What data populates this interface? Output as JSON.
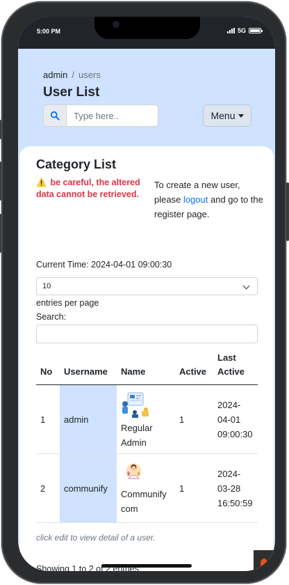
{
  "status_bar": {
    "time": "5:00 PM",
    "network": "5G"
  },
  "breadcrumb": {
    "root": "admin",
    "separator": "/",
    "current": "users"
  },
  "page_title": "User List",
  "search": {
    "placeholder": "Type here.."
  },
  "menu_button": "Menu",
  "card": {
    "title": "Category List",
    "warning": "be careful, the altered data cannot be retrieved.",
    "info_before": "To create a new user, please",
    "info_link": "logout",
    "info_after": "and go to the register page."
  },
  "current_time": "Current Time: 2024-04-01 09:00:30",
  "entries_select": "10",
  "entries_label": "entries per page",
  "search_label": "Search:",
  "table": {
    "headers": [
      "No",
      "Username",
      "Name",
      "Active",
      "Last Active"
    ],
    "rows": [
      {
        "no": "1",
        "username": "admin",
        "name": "Regular Admin",
        "active": "1",
        "last_active": "2024-04-01 09:00:30"
      },
      {
        "no": "2",
        "username": "communify",
        "name": "Communify com",
        "active": "1",
        "last_active": "2024-03-28 16:50:59"
      }
    ]
  },
  "note": "click edit to view detail of a user.",
  "showing": "Showing 1 to 2 of 2 entries",
  "colors": {
    "header_bg": "#cfe2ff",
    "warning": "#dc3545",
    "link": "#0d6efd"
  }
}
